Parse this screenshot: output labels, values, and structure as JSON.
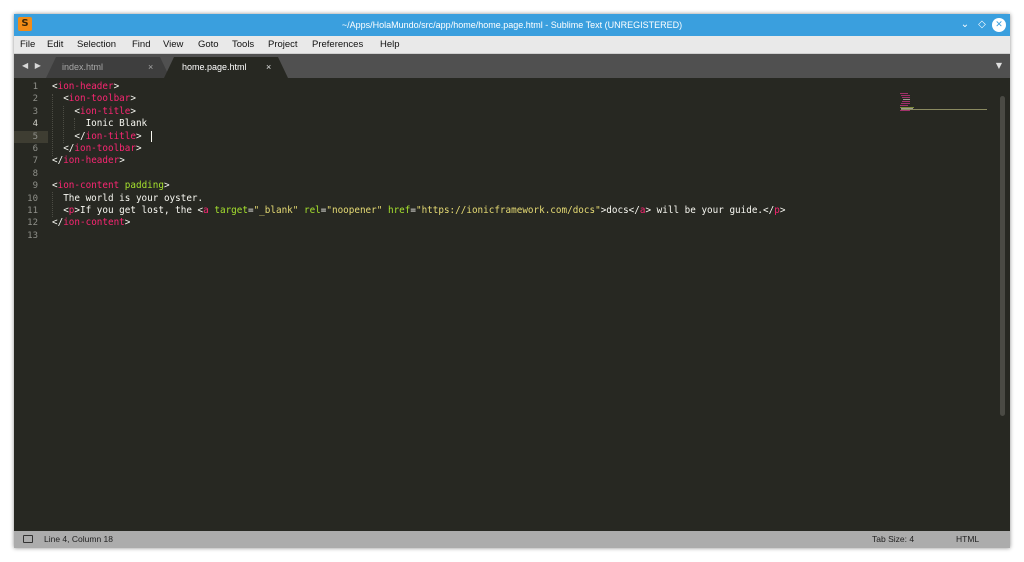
{
  "window": {
    "title": "~/Apps/HolaMundo/src/app/home/home.page.html - Sublime Text (UNREGISTERED)",
    "app_icon_glyph": "S",
    "controls": {
      "minimize": "⌄",
      "maximize": "◇",
      "close": "✕"
    }
  },
  "menu": {
    "items": [
      "File",
      "Edit",
      "Selection",
      "Find",
      "View",
      "Goto",
      "Tools",
      "Project",
      "Preferences",
      "Help"
    ]
  },
  "tabs": {
    "nav_arrows": "◀ ▶",
    "items": [
      {
        "label": "index.html",
        "close": "×",
        "active": false
      },
      {
        "label": "home.page.html",
        "close": "×",
        "active": true
      }
    ],
    "overflow": "▼"
  },
  "editor": {
    "current_line": 4,
    "lines": [
      {
        "n": "1",
        "tokens": [
          [
            "p",
            "<"
          ],
          [
            "t",
            "ion-header"
          ],
          [
            "p",
            ">"
          ]
        ]
      },
      {
        "n": "2",
        "tokens": [
          [
            "p",
            "  <"
          ],
          [
            "t",
            "ion-toolbar"
          ],
          [
            "p",
            ">"
          ]
        ]
      },
      {
        "n": "3",
        "tokens": [
          [
            "p",
            "    <"
          ],
          [
            "t",
            "ion-title"
          ],
          [
            "p",
            ">"
          ]
        ]
      },
      {
        "n": "4",
        "tokens": [
          [
            "p",
            "      Ionic Blank"
          ]
        ]
      },
      {
        "n": "5",
        "tokens": [
          [
            "p",
            "    </"
          ],
          [
            "t",
            "ion-title"
          ],
          [
            "p",
            ">"
          ]
        ]
      },
      {
        "n": "6",
        "tokens": [
          [
            "p",
            "  </"
          ],
          [
            "t",
            "ion-toolbar"
          ],
          [
            "p",
            ">"
          ]
        ]
      },
      {
        "n": "7",
        "tokens": [
          [
            "p",
            "</"
          ],
          [
            "t",
            "ion-header"
          ],
          [
            "p",
            ">"
          ]
        ]
      },
      {
        "n": "8",
        "tokens": []
      },
      {
        "n": "9",
        "tokens": [
          [
            "p",
            "<"
          ],
          [
            "t",
            "ion-content"
          ],
          [
            "p",
            " "
          ],
          [
            "a",
            "padding"
          ],
          [
            "p",
            ">"
          ]
        ]
      },
      {
        "n": "10",
        "tokens": [
          [
            "p",
            "  The world is your oyster."
          ]
        ]
      },
      {
        "n": "11",
        "tokens": [
          [
            "p",
            "  <"
          ],
          [
            "t",
            "p"
          ],
          [
            "p",
            ">If you get lost, the <"
          ],
          [
            "t",
            "a"
          ],
          [
            "p",
            " "
          ],
          [
            "a",
            "target"
          ],
          [
            "p",
            "="
          ],
          [
            "s",
            "\"_blank\""
          ],
          [
            "p",
            " "
          ],
          [
            "a",
            "rel"
          ],
          [
            "p",
            "="
          ],
          [
            "s",
            "\"noopener\""
          ],
          [
            "p",
            " "
          ],
          [
            "a",
            "href"
          ],
          [
            "p",
            "="
          ],
          [
            "s",
            "\"https://ionicframework.com/docs\""
          ],
          [
            "p",
            ">docs</"
          ],
          [
            "t",
            "a"
          ],
          [
            "p",
            "> will be your guide.</"
          ],
          [
            "t",
            "p"
          ],
          [
            "p",
            ">"
          ]
        ]
      },
      {
        "n": "12",
        "tokens": [
          [
            "p",
            "</"
          ],
          [
            "t",
            "ion-content"
          ],
          [
            "p",
            ">"
          ]
        ]
      },
      {
        "n": "13",
        "tokens": []
      }
    ]
  },
  "status": {
    "position": "Line 4, Column 18",
    "tab_size": "Tab Size: 4",
    "syntax": "HTML"
  },
  "colors": {
    "titlebar": "#3a9fde",
    "editor_bg": "#272822",
    "tag": "#f92672",
    "attribute": "#a6e22e",
    "string": "#e6db74",
    "text": "#f8f8f2"
  }
}
